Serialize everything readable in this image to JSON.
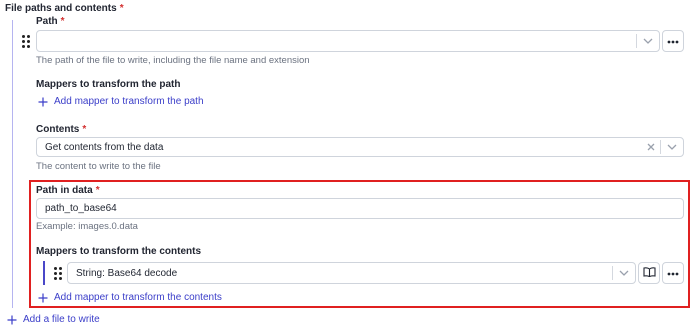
{
  "section": {
    "title": "File paths and contents",
    "required_mark": "*"
  },
  "path": {
    "label": "Path",
    "required_mark": "*",
    "value": "",
    "help": "The path of the file to write, including the file name and extension"
  },
  "path_mappers": {
    "label": "Mappers to transform the path",
    "add_label": "Add mapper to transform the path"
  },
  "contents": {
    "label": "Contents",
    "required_mark": "*",
    "value": "Get contents from the data",
    "help": "The content to write to the file"
  },
  "path_in_data": {
    "label": "Path in data",
    "required_mark": "*",
    "value": "path_to_base64",
    "example": "Example: images.0.data"
  },
  "content_mappers": {
    "label": "Mappers to transform the contents",
    "items": [
      {
        "value": "String: Base64 decode"
      }
    ],
    "add_label": "Add mapper to transform the contents"
  },
  "add_file_label": "Add a file to write",
  "colors": {
    "accent": "#3b3ec9",
    "required": "#d22f2f",
    "highlight_border": "#e02020"
  },
  "icons": [
    "drag-handle-icon",
    "chevron-down-icon",
    "clear-icon",
    "more-icon",
    "book-icon",
    "plus-icon"
  ]
}
